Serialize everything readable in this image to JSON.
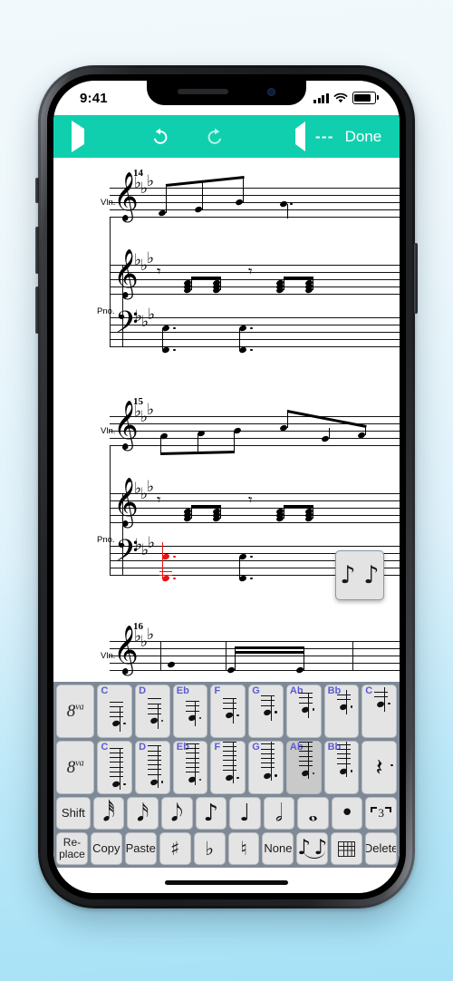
{
  "status_bar": {
    "time": "9:41",
    "signal_icon": "cellular-bars-icon",
    "wifi_icon": "wifi-icon",
    "battery_icon": "battery-full-icon"
  },
  "toolbar": {
    "accent_color": "#10cfae",
    "play_label": "play-icon",
    "undo_label": "undo-icon",
    "redo_label": "redo-icon",
    "speaker_label": "speaker-icon",
    "tempo_text": "---",
    "done_label": "Done"
  },
  "score": {
    "systems": [
      {
        "measure": "14",
        "staves": [
          {
            "instrument": "Vln.",
            "clef": "treble",
            "key_signature": "3 flats"
          },
          {
            "instrument": "Pno.",
            "clef": "treble",
            "key_signature": "3 flats"
          },
          {
            "instrument": "",
            "clef": "bass",
            "key_signature": "3 flats"
          }
        ]
      },
      {
        "measure": "15",
        "staves": [
          {
            "instrument": "Vln.",
            "clef": "treble",
            "key_signature": "3 flats"
          },
          {
            "instrument": "Pno.",
            "clef": "treble",
            "key_signature": "3 flats"
          },
          {
            "instrument": "",
            "clef": "bass",
            "key_signature": "3 flats"
          }
        ]
      },
      {
        "measure": "16",
        "staves": [
          {
            "instrument": "Vln.",
            "clef": "treble",
            "key_signature": "3 flats"
          }
        ]
      }
    ],
    "selected_note_color": "#ee1111"
  },
  "popup": {
    "name": "note-preview-popup",
    "glyph_left": "♪",
    "glyph_right": "♪"
  },
  "keyboard": {
    "background_color": "#7d8996",
    "key_color": "#e4e4e4",
    "selected_key_color": "#c9c9c9",
    "label_color": "#5b5bd6",
    "row_octave_low": {
      "ottava_label": "8va",
      "keys": [
        {
          "label": "C",
          "selected": false
        },
        {
          "label": "D",
          "selected": false
        },
        {
          "label": "Eb",
          "selected": false
        },
        {
          "label": "F",
          "selected": false
        },
        {
          "label": "G",
          "selected": false
        },
        {
          "label": "Ab",
          "selected": false
        },
        {
          "label": "Bb",
          "selected": false
        },
        {
          "label": "C",
          "selected": false
        }
      ]
    },
    "row_octave_high": {
      "ottava_label": "8va",
      "keys": [
        {
          "label": "C",
          "selected": false
        },
        {
          "label": "D",
          "selected": false
        },
        {
          "label": "Eb",
          "selected": false
        },
        {
          "label": "F",
          "selected": false
        },
        {
          "label": "G",
          "selected": false
        },
        {
          "label": "Ab",
          "selected": true
        },
        {
          "label": "Bb",
          "selected": false
        },
        {
          "label": "rest",
          "selected": false
        }
      ]
    },
    "row_durations": {
      "shift_label": "Shift",
      "items": [
        {
          "name": "thirty-second-note",
          "glyph": "♬"
        },
        {
          "name": "sixteenth-note",
          "glyph": "♬"
        },
        {
          "name": "eighth-note-beamed",
          "glyph": "♪"
        },
        {
          "name": "eighth-note",
          "glyph": "♪"
        },
        {
          "name": "quarter-note",
          "glyph": "♩"
        },
        {
          "name": "half-note",
          "glyph": "ᴕe"
        },
        {
          "name": "whole-note",
          "glyph": "ᴕd"
        },
        {
          "name": "augmentation-dot",
          "glyph": "•"
        },
        {
          "name": "triplet",
          "glyph": "3"
        }
      ]
    },
    "row_actions": {
      "items": [
        {
          "label": "Re-\nplace",
          "name": "replace-key"
        },
        {
          "label": "Copy",
          "name": "copy-key"
        },
        {
          "label": "Paste",
          "name": "paste-key"
        },
        {
          "label": "♯",
          "name": "sharp-key"
        },
        {
          "label": "♭",
          "name": "flat-key"
        },
        {
          "label": "♮",
          "name": "natural-key"
        },
        {
          "label": "None",
          "name": "none-key"
        },
        {
          "label": "",
          "name": "tie-key"
        },
        {
          "label": "",
          "name": "fretboard-key"
        },
        {
          "label": "Delete",
          "name": "delete-key"
        }
      ]
    }
  }
}
